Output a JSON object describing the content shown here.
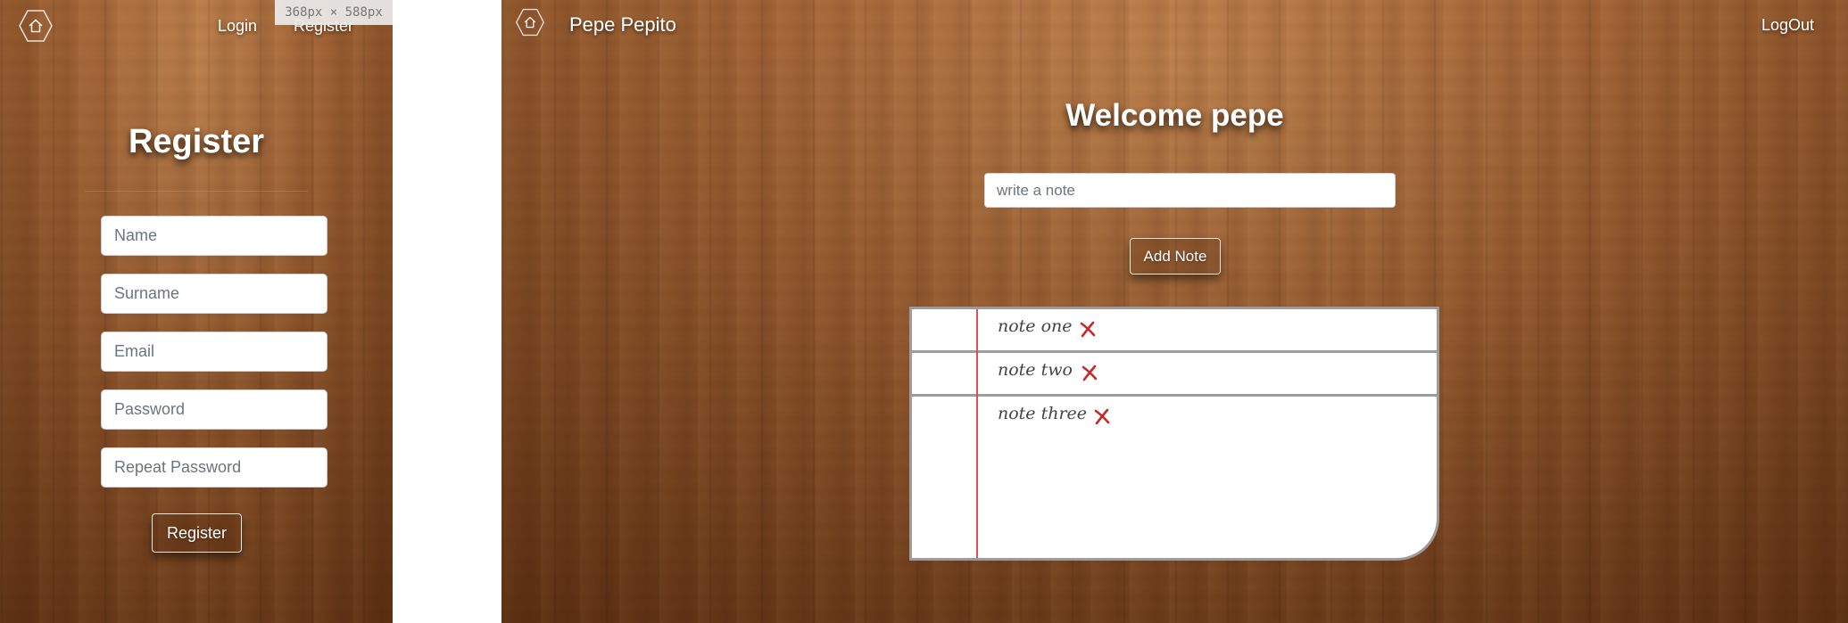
{
  "left": {
    "nav": {
      "login": "Login",
      "register": "Register"
    },
    "size_badge": "368px  ×  588px",
    "title": "Register",
    "fields": [
      {
        "placeholder": "Name"
      },
      {
        "placeholder": "Surname"
      },
      {
        "placeholder": "Email"
      },
      {
        "placeholder": "Password"
      },
      {
        "placeholder": "Repeat Password"
      }
    ],
    "submit_label": "Register"
  },
  "right": {
    "brand": "Pepe Pepito",
    "logout": "LogOut",
    "welcome": "Welcome pepe",
    "note_placeholder": "write a note",
    "add_label": "Add Note",
    "notes": [
      {
        "text": "note one"
      },
      {
        "text": "note two"
      },
      {
        "text": "note three"
      }
    ]
  },
  "colors": {
    "delete_x": "#c62828",
    "margin_line": "#e05050"
  },
  "icons": {
    "home": "home-icon",
    "delete": "delete-x-icon"
  }
}
